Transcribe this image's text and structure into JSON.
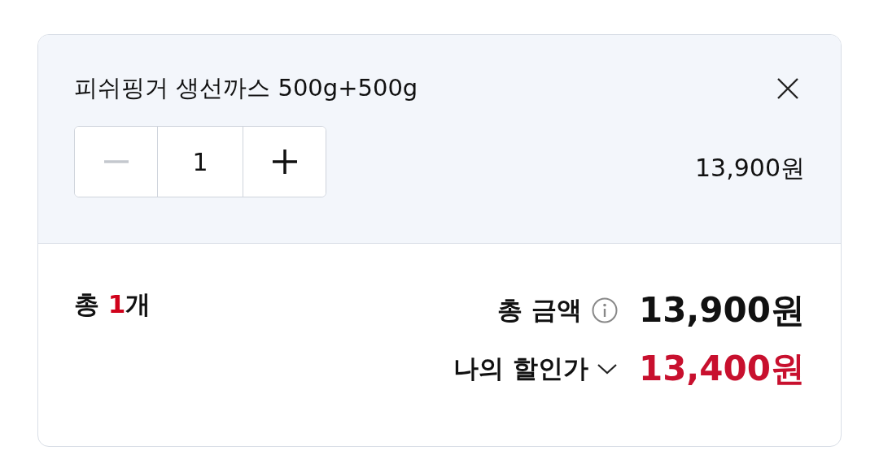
{
  "product": {
    "name": "피쉬핑거 생선까스 500g+500g",
    "price": "13,900원"
  },
  "stepper": {
    "buttons": [
      {
        "kind": "minus",
        "disabled": true
      },
      {
        "kind": "plus",
        "disabled": false
      }
    ],
    "quantity": "1"
  },
  "summary": {
    "count": {
      "prefix": "총 ",
      "value": "1",
      "suffix": "개"
    },
    "total_label": "총 금액",
    "total": "13,900원",
    "discount_label": "나의 할인가",
    "discount_expanded": false,
    "discount_price": "13,400원"
  }
}
